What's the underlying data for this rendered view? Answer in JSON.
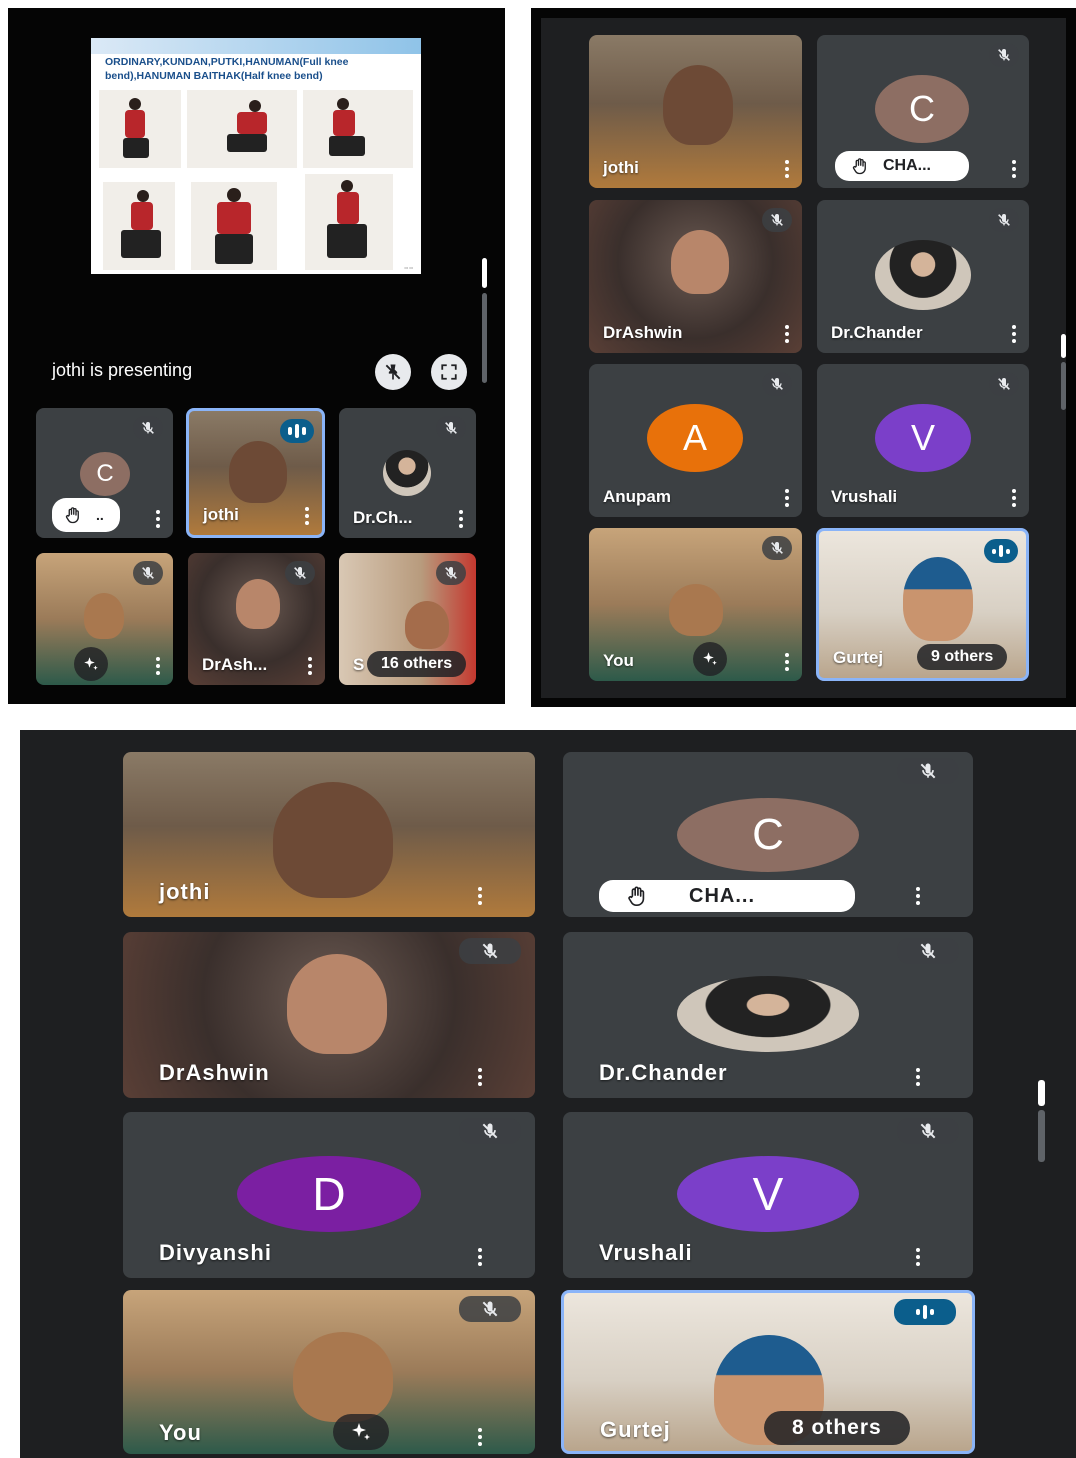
{
  "panel1": {
    "slide": {
      "title": "ORDINARY,KUNDAN,PUTKI,HANUMAN(Full knee bend),HANUMAN BAITHAK(Half knee bend)"
    },
    "presenting_label": "jothi is presenting",
    "tiles": [
      {
        "name": "..",
        "avatar_letter": "C",
        "avatar_color": "#8d6e63"
      },
      {
        "name": "jothi"
      },
      {
        "name": "Dr.Ch..."
      },
      {
        "name": ""
      },
      {
        "name": "DrAsh..."
      },
      {
        "name": "S",
        "others": "16 others"
      }
    ]
  },
  "panel2": {
    "tiles": [
      {
        "name": "jothi"
      },
      {
        "name": "CHA...",
        "avatar_letter": "C",
        "avatar_color": "#8d6e63"
      },
      {
        "name": "DrAshwin"
      },
      {
        "name": "Dr.Chander"
      },
      {
        "name": "Anupam",
        "avatar_letter": "A",
        "avatar_color": "#e8710a"
      },
      {
        "name": "Vrushali",
        "avatar_letter": "V",
        "avatar_color": "#7b3fc9"
      },
      {
        "name": "You"
      },
      {
        "name": "Gurtej",
        "others": "9 others"
      }
    ]
  },
  "panel3": {
    "tiles": [
      {
        "name": "jothi"
      },
      {
        "name": "CHA...",
        "avatar_letter": "C",
        "avatar_color": "#8d6e63"
      },
      {
        "name": "DrAshwin"
      },
      {
        "name": "Dr.Chander"
      },
      {
        "name": "Divyanshi",
        "avatar_letter": "D",
        "avatar_color": "#7b1fa2"
      },
      {
        "name": "Vrushali",
        "avatar_letter": "V",
        "avatar_color": "#7b3fc9"
      },
      {
        "name": "You"
      },
      {
        "name": "Gurtej",
        "others": "8 others"
      }
    ]
  },
  "icons": {
    "mic_off": "mic-off-icon",
    "speaking": "speaking-indicator-icon",
    "more": "more-vert-icon",
    "hand": "raised-hand-icon",
    "effects": "sparkle-effects-icon",
    "pin_off": "pin-off-icon",
    "fullscreen": "fullscreen-icon"
  }
}
